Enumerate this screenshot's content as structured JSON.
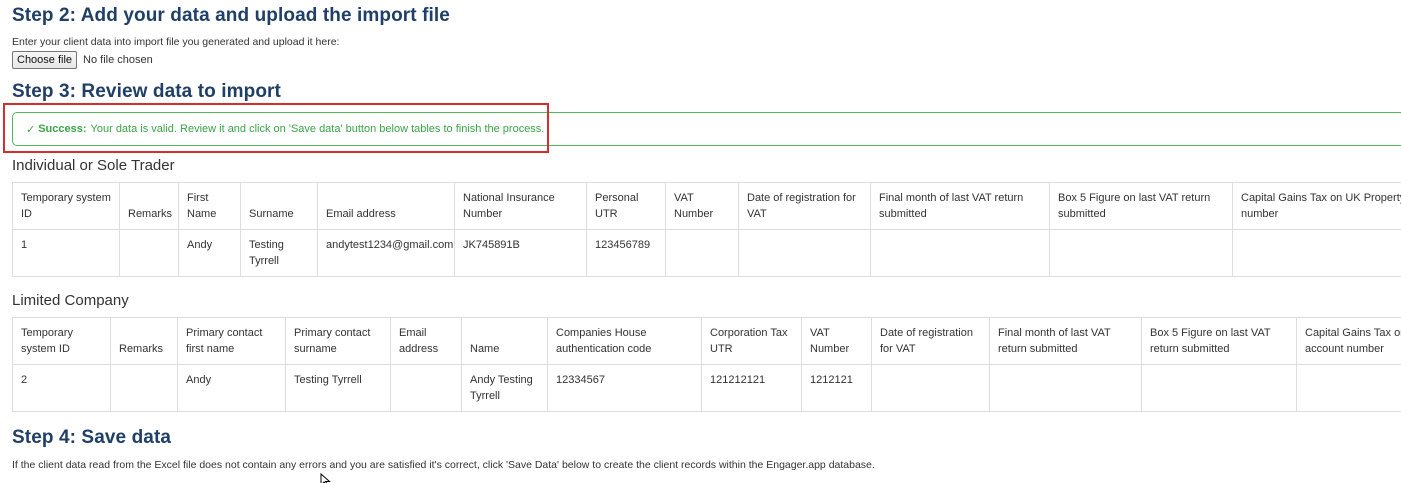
{
  "step2": {
    "title": "Step 2: Add your data and upload the import file",
    "instruction": "Enter your client data into import file you generated and upload it here:",
    "choose_file_label": "Choose file",
    "file_status": "No file chosen"
  },
  "step3": {
    "title": "Step 3: Review data to import",
    "alert": {
      "check_icon": "✓",
      "strong": "Success:",
      "message": "Your data is valid. Review it and click on 'Save data' button below tables to finish the process."
    }
  },
  "individual": {
    "title": "Individual or Sole Trader",
    "headers": [
      "Temporary system ID",
      "Remarks",
      "First Name",
      "Surname",
      "Email address",
      "National Insurance Number",
      "Personal UTR",
      "VAT Number",
      "Date of registration for VAT",
      "Final month of last VAT return submitted",
      "Box 5 Figure on last VAT return submitted",
      "Capital Gains Tax on UK Property account number"
    ],
    "rows": [
      [
        "1",
        "",
        "Andy",
        "Testing Tyrrell",
        "andytest1234@gmail.com",
        "JK745891B",
        "123456789",
        "",
        "",
        "",
        "",
        ""
      ]
    ]
  },
  "company": {
    "title": "Limited Company",
    "headers": [
      "Temporary system ID",
      "Remarks",
      "Primary contact first name",
      "Primary contact surname",
      "Email address",
      "Name",
      "Companies House authentication code",
      "Corporation Tax UTR",
      "VAT Number",
      "Date of registration for VAT",
      "Final month of last VAT return submitted",
      "Box 5 Figure on last VAT return submitted",
      "Capital Gains Tax on UK Property account number"
    ],
    "rows": [
      [
        "2",
        "",
        "Andy",
        "Testing Tyrrell",
        "",
        "Andy Testing Tyrrell",
        "12334567",
        "121212121",
        "1212121",
        "",
        "",
        "",
        ""
      ]
    ]
  },
  "step4": {
    "title": "Step 4: Save data",
    "text": "If the client data read from the Excel file does not contain any errors and you are satisfied it's correct, click 'Save Data' below to create the client records within the Engager.app database."
  },
  "colors": {
    "heading": "#1f3f66",
    "success": "#3aa547",
    "highlight": "#d42e2e"
  }
}
